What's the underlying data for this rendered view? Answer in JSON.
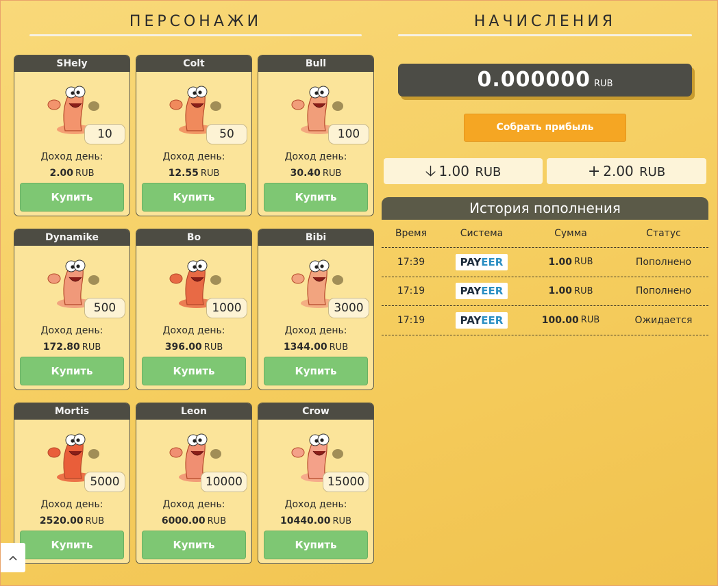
{
  "characters_section": {
    "title": "ПЕРСОНАЖИ"
  },
  "earnings_section": {
    "title": "НАЧИСЛЕНИЯ"
  },
  "income_label": "Доход день:",
  "currency": "RUB",
  "buy_label": "Купить",
  "characters": [
    {
      "name": "SHely",
      "price": "10",
      "income": "2.00",
      "color": "#f3946d"
    },
    {
      "name": "Colt",
      "price": "50",
      "income": "12.55",
      "color": "#f08a5c"
    },
    {
      "name": "Bull",
      "price": "100",
      "income": "30.40",
      "color": "#f19e7a"
    },
    {
      "name": "Dynamike",
      "price": "500",
      "income": "172.80",
      "color": "#f0997a"
    },
    {
      "name": "Bo",
      "price": "1000",
      "income": "396.00",
      "color": "#e86a45"
    },
    {
      "name": "Bibi",
      "price": "3000",
      "income": "1344.00",
      "color": "#f2a47f"
    },
    {
      "name": "Mortis",
      "price": "5000",
      "income": "2520.00",
      "color": "#e95e3a"
    },
    {
      "name": "Leon",
      "price": "10000",
      "income": "6000.00",
      "color": "#f08f72"
    },
    {
      "name": "Crow",
      "price": "15000",
      "income": "10440.00",
      "color": "#f4a189"
    }
  ],
  "balance": {
    "amount": "0.000000",
    "currency": "RUB"
  },
  "collect_button": "Собрать прибыль",
  "stats": {
    "withdrawn": {
      "amount": "1.00",
      "currency": "RUB"
    },
    "deposited": {
      "amount": "2.00",
      "currency": "RUB"
    }
  },
  "history": {
    "title": "История пополнения",
    "columns": [
      "Время",
      "Система",
      "Сумма",
      "Статус"
    ],
    "rows": [
      {
        "time": "17:39",
        "system_a": "PAY",
        "system_b": "EER",
        "amount": "1.00",
        "currency": "RUB",
        "status": "Пополнено"
      },
      {
        "time": "17:19",
        "system_a": "PAY",
        "system_b": "EER",
        "amount": "1.00",
        "currency": "RUB",
        "status": "Пополнено"
      },
      {
        "time": "17:19",
        "system_a": "PAY",
        "system_b": "EER",
        "amount": "100.00",
        "currency": "RUB",
        "status": "Ожидается"
      }
    ]
  }
}
